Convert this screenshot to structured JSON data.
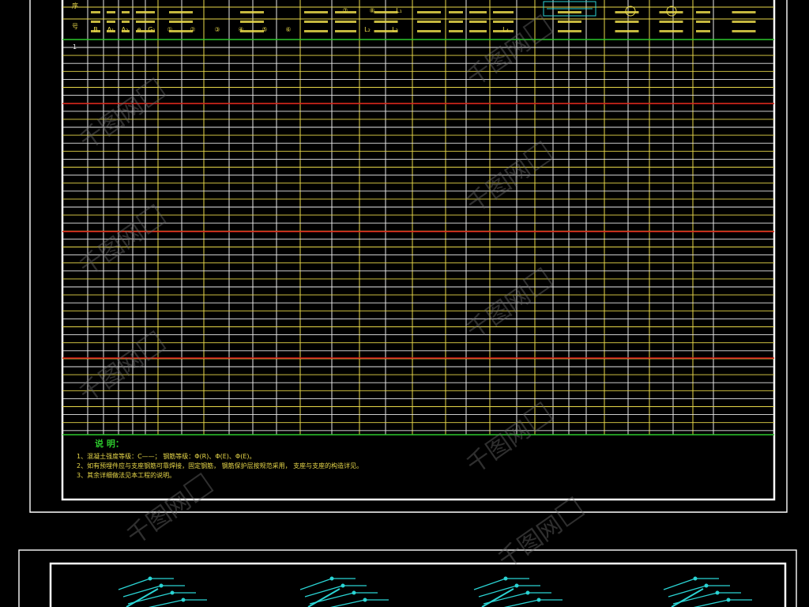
{
  "sheet_top": {
    "row_marker": "1",
    "header_cells": [
      "序",
      "号",
      "B",
      "A₁",
      "A₂",
      "e",
      "G₁",
      "①",
      "②",
      "③",
      "④",
      "⑤",
      "⑥",
      "⑦",
      "⑧",
      "L₁",
      "L₂",
      "L₃",
      "L₄"
    ],
    "notes_title": "说    明：",
    "notes": [
      "1、混凝土强度等级：C——；   钢筋等级：Φ(R)、Φ(E)、Φ(E)。",
      "2、如有预埋件应与支座钢筋可靠焊接，固定钢筋，   钢筋保护层按规范采用，   支座与支座的构造详见。",
      "3、其余详细做法见本工程的说明。"
    ]
  },
  "colors": {
    "background": "#000000",
    "frame": "#ffffff",
    "grid_white": "#e8e8e8",
    "grid_yellow": "#e8d84a",
    "rule_red": "#d81818",
    "rule_green": "#2cc82c",
    "header_text": "#e8d84a",
    "notes_title": "#2cc82c",
    "notes_text": "#e8d84a",
    "drawing_cyan": "#2ad4d4",
    "watermark": "#6a6a6a"
  },
  "bottom_sheet": {
    "detail_count": 4
  },
  "watermark": {
    "text": "千图网"
  }
}
